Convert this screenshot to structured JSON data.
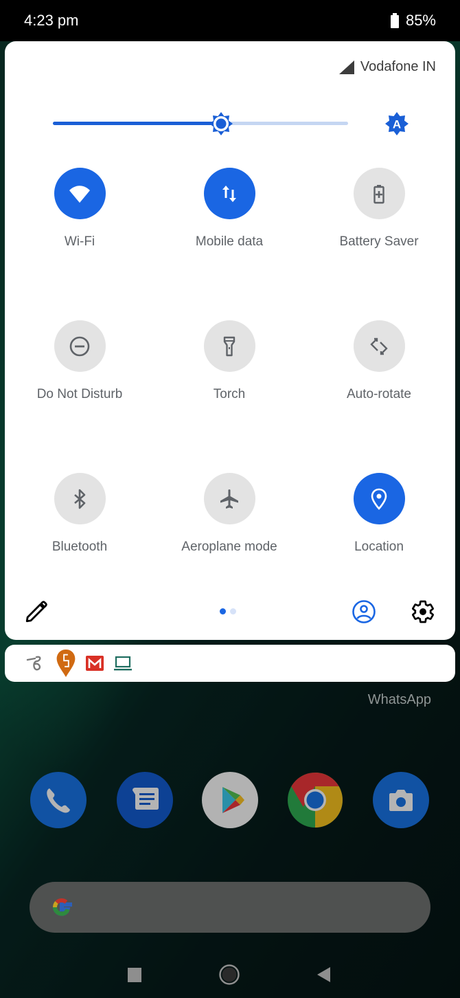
{
  "status_bar": {
    "time": "4:23 pm",
    "battery_percent": "85%",
    "battery_icon": "battery-icon"
  },
  "quick_settings": {
    "carrier": "Vodafone IN",
    "signal_icon": "cellular-signal-icon",
    "brightness": {
      "level_fraction": 0.57,
      "auto_icon": "auto-brightness-icon"
    },
    "tiles": [
      {
        "label": "Wi-Fi",
        "icon": "wifi-icon",
        "active": true
      },
      {
        "label": "Mobile data",
        "icon": "mobile-data-icon",
        "active": true
      },
      {
        "label": "Battery Saver",
        "icon": "battery-saver-icon",
        "active": false
      },
      {
        "label": "Do Not Disturb",
        "icon": "do-not-disturb-icon",
        "active": false
      },
      {
        "label": "Torch",
        "icon": "torch-icon",
        "active": false
      },
      {
        "label": "Auto-rotate",
        "icon": "auto-rotate-icon",
        "active": false
      },
      {
        "label": "Bluetooth",
        "icon": "bluetooth-icon",
        "active": false
      },
      {
        "label": "Aeroplane mode",
        "icon": "aeroplane-icon",
        "active": false
      },
      {
        "label": "Location",
        "icon": "location-icon",
        "active": true
      }
    ],
    "footer": {
      "page_count": 2,
      "current_page": 1
    },
    "colors": {
      "active": "#1a66e3",
      "inactive": "#e3e3e3",
      "active_icon": "#ffffff",
      "inactive_icon": "#5f6368"
    }
  },
  "notification_icons": [
    {
      "name": "fancy-s-app-icon",
      "color": "#7a7a7a"
    },
    {
      "name": "swiggy-icon",
      "color": "#d06a12"
    },
    {
      "name": "gmail-icon",
      "color": "#d93025"
    },
    {
      "name": "laptop-icon",
      "color": "#1f6e60"
    }
  ],
  "home": {
    "widget_label": "WhatsApp",
    "dock": [
      {
        "name": "phone-app",
        "icon": "phone-icon"
      },
      {
        "name": "messages-app",
        "icon": "messages-icon"
      },
      {
        "name": "play-store-app",
        "icon": "play-store-icon"
      },
      {
        "name": "chrome-app",
        "icon": "chrome-icon"
      },
      {
        "name": "camera-app",
        "icon": "camera-icon"
      }
    ],
    "search_bar": {
      "icon": "google-logo-icon"
    }
  },
  "navigation": {
    "recents": "recents-button",
    "home": "home-button",
    "back": "back-button"
  }
}
